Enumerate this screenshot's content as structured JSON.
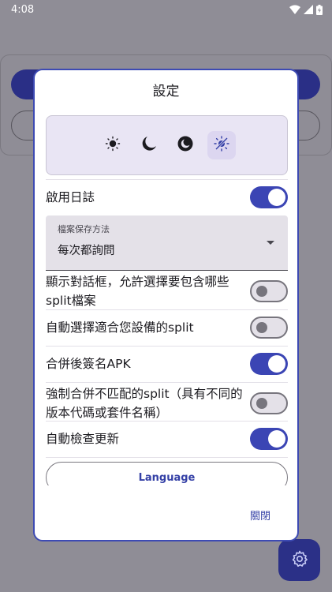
{
  "status_bar": {
    "time": "4:08",
    "icons": [
      "wifi-icon",
      "signal-icon",
      "battery-icon"
    ]
  },
  "background": {
    "fab_icon": "gear-icon"
  },
  "dialog": {
    "title": "設定",
    "theme_options": [
      {
        "name": "light-theme-icon",
        "selected": false
      },
      {
        "name": "dark-theme-icon",
        "selected": false
      },
      {
        "name": "amoled-theme-icon",
        "selected": false
      },
      {
        "name": "system-theme-icon",
        "selected": true
      }
    ],
    "settings": [
      {
        "label": "啟用日誌",
        "checked": true
      },
      {
        "label": "顯示對話框，允許選擇要包含哪些split檔案",
        "checked": false
      },
      {
        "label": "自動選擇適合您設備的split",
        "checked": false
      },
      {
        "label": "合併後簽名APK",
        "checked": true
      },
      {
        "label": "強制合併不匹配的split（具有不同的版本代碼或套件名稱）",
        "checked": false
      },
      {
        "label": "自動檢查更新",
        "checked": true
      }
    ],
    "save_method": {
      "label": "檔案保存方法",
      "value": "每次都詢問"
    },
    "language_button": "Language",
    "close_button": "關閉"
  },
  "colors": {
    "accent": "#3b45b4",
    "scrim": "#8f8d96",
    "switch_off": "#e4e1e8"
  }
}
